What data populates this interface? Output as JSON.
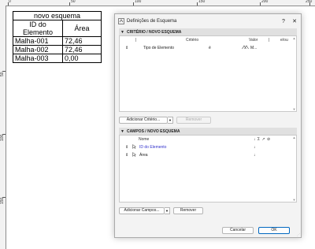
{
  "ruler_top": {
    "labels": [
      "0",
      "50",
      "100",
      "150",
      "200",
      "250"
    ]
  },
  "ruler_left": {
    "labels": [
      "50",
      "100",
      "150"
    ]
  },
  "schedule": {
    "title": "novo esquema",
    "headers": [
      "ID do Elemento",
      "Área"
    ],
    "rows": [
      [
        "Malha-001",
        "72,46"
      ],
      [
        "Malha-002",
        "72,46"
      ],
      [
        "Malha-003",
        "0,00"
      ]
    ]
  },
  "dialog": {
    "title": "Definições de Esquema",
    "help": "?",
    "close": "✕",
    "criteria": {
      "header": "CRITÉRIO / NOVO ESQUEMA",
      "columns": {
        "bar": "|",
        "criterio": "Critério",
        "valor": "Valor",
        "bar2": "|",
        "eou": "e/ou"
      },
      "rows": [
        {
          "marker": "⇕",
          "criterio": "Tipo de Elemento",
          "op": "é",
          "valor": "M..."
        }
      ],
      "add_button": "Adicionar Critério...",
      "remove_button": "Remover"
    },
    "fields": {
      "header": "CAMPOS / NOVO ESQUEMA",
      "columns": {
        "name": "Nome",
        "icons": "↓ Σ ↗ ⊘"
      },
      "rows": [
        {
          "marker": "⇕",
          "name": "ID do Elemento",
          "sort": "↓",
          "highlight": true
        },
        {
          "marker": "⇕",
          "name": "Área",
          "sort": "↓",
          "highlight": false
        }
      ],
      "add_button": "Adicionar Campos...",
      "remove_button": "Remover"
    },
    "cancel": "Cancelar",
    "ok": "OK"
  },
  "colors": {
    "accent": "#0067c0",
    "link": "#3333cc"
  }
}
